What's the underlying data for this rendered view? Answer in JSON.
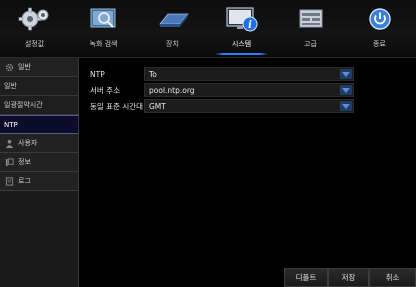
{
  "toolbar": {
    "items": [
      {
        "label": "설정값",
        "icon": "gears-icon"
      },
      {
        "label": "녹화 검색",
        "icon": "search-playback-icon"
      },
      {
        "label": "장치",
        "icon": "hard-drive-icon"
      },
      {
        "label": "시스템",
        "icon": "system-info-icon"
      },
      {
        "label": "고급",
        "icon": "advanced-panel-icon"
      },
      {
        "label": "종료",
        "icon": "power-icon"
      }
    ],
    "active_index": 3,
    "accent_color": "#2e7bff"
  },
  "sidebar": {
    "items": [
      {
        "label": "일반",
        "icon": "gear-icon",
        "type": "header"
      },
      {
        "label": "일반",
        "type": "sub"
      },
      {
        "label": "일광절약시간",
        "type": "sub"
      },
      {
        "label": "NTP",
        "type": "sub",
        "selected": true
      },
      {
        "label": "사용자",
        "icon": "user-icon",
        "type": "header"
      },
      {
        "label": "정보",
        "icon": "info-icon",
        "type": "header"
      },
      {
        "label": "로그",
        "icon": "log-icon",
        "type": "header"
      }
    ]
  },
  "ntp": {
    "ntp_label": "NTP",
    "ntp_value": "To",
    "server_label": "서버 주소",
    "server_value": "pool.ntp.org",
    "timezone_label": "동일 표준 시간대",
    "timezone_value": "GMT"
  },
  "buttons": {
    "default_label": "디폴트",
    "save_label": "저장",
    "cancel_label": "취소"
  }
}
